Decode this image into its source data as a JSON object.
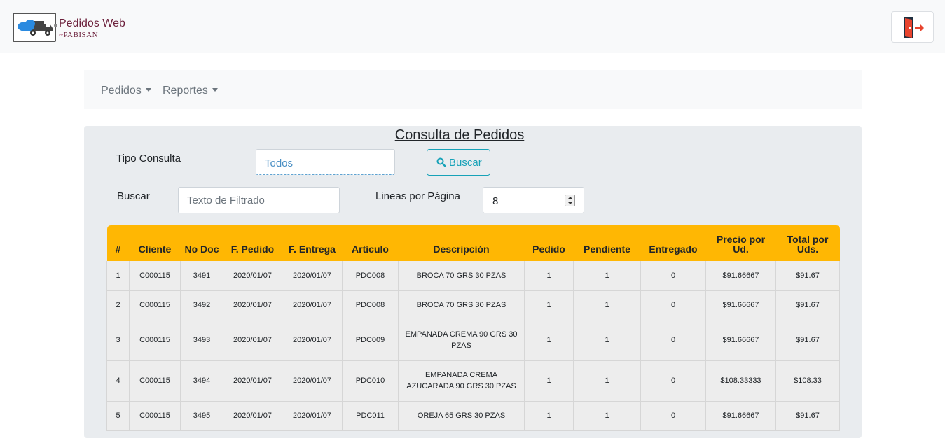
{
  "header": {
    "logo_title": "Pedidos Web",
    "logo_subtitle": "PABISAN"
  },
  "icons": {
    "logo": "delivery-truck-icon",
    "logout": "exit-door-icon",
    "search": "search-icon"
  },
  "colors": {
    "table_header": "#ffb703",
    "accent": "#17a2b8",
    "panel_bg": "#e9ecef"
  },
  "nav": {
    "items": [
      {
        "label": "Pedidos"
      },
      {
        "label": "Reportes"
      }
    ]
  },
  "main": {
    "title": "Consulta de Pedidos",
    "tipo_consulta_label": "Tipo Consulta",
    "tipo_consulta_value": "Todos",
    "buscar_button": "Buscar",
    "buscar_label": "Buscar",
    "filter_placeholder": "Texto de Filtrado",
    "lineas_label": "Lineas por Página",
    "lineas_value": "8"
  },
  "table": {
    "headers": [
      "#",
      "Cliente",
      "No Doc",
      "F. Pedido",
      "F. Entrega",
      "Artículo",
      "Descripción",
      "Pedido",
      "Pendiente",
      "Entregado",
      "Precio por Ud.",
      "Total por Uds."
    ],
    "rows": [
      [
        "1",
        "C000115",
        "3491",
        "2020/01/07",
        "2020/01/07",
        "PDC008",
        "BROCA 70 GRS 30 PZAS",
        "1",
        "1",
        "0",
        "$91.66667",
        "$91.67"
      ],
      [
        "2",
        "C000115",
        "3492",
        "2020/01/07",
        "2020/01/07",
        "PDC008",
        "BROCA 70 GRS 30 PZAS",
        "1",
        "1",
        "0",
        "$91.66667",
        "$91.67"
      ],
      [
        "3",
        "C000115",
        "3493",
        "2020/01/07",
        "2020/01/07",
        "PDC009",
        "EMPANADA CREMA 90 GRS 30 PZAS",
        "1",
        "1",
        "0",
        "$91.66667",
        "$91.67"
      ],
      [
        "4",
        "C000115",
        "3494",
        "2020/01/07",
        "2020/01/07",
        "PDC010",
        "EMPANADA CREMA AZUCARADA 90 GRS 30 PZAS",
        "1",
        "1",
        "0",
        "$108.33333",
        "$108.33"
      ],
      [
        "5",
        "C000115",
        "3495",
        "2020/01/07",
        "2020/01/07",
        "PDC011",
        "OREJA 65 GRS 30 PZAS",
        "1",
        "1",
        "0",
        "$91.66667",
        "$91.67"
      ]
    ]
  }
}
